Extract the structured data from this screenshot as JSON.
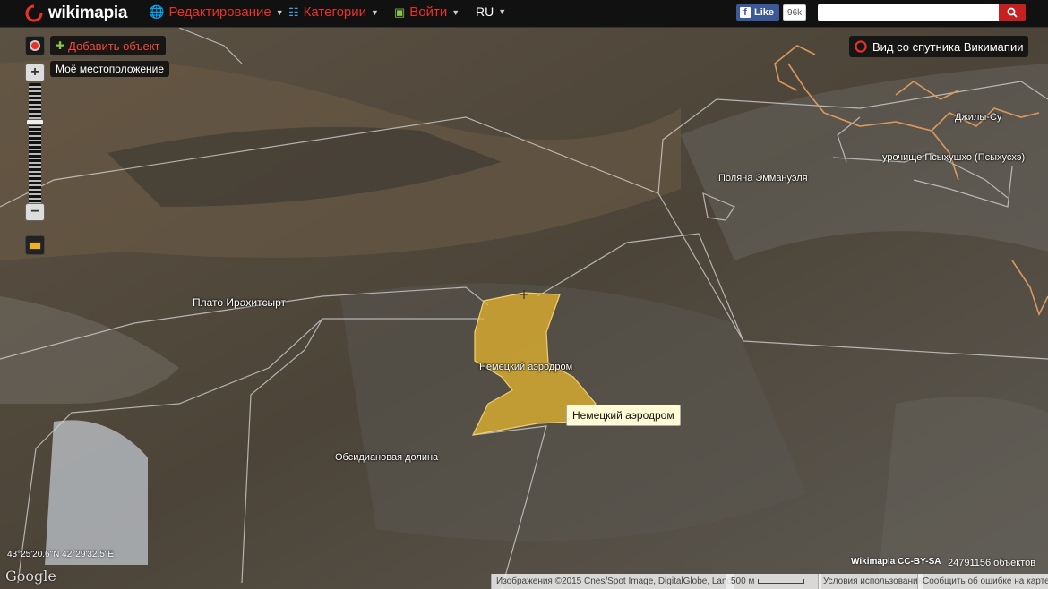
{
  "app": {
    "brand": "wikimapia",
    "brand_color": "#e8322c"
  },
  "topbar": {
    "menu_edit": "Редактирование",
    "menu_categories": "Категории",
    "menu_login": "Войти",
    "menu_lang": "RU",
    "fb_like": "Like",
    "fb_count": "96k",
    "search_placeholder": ""
  },
  "controls": {
    "add_object": "Добавить объект",
    "my_location": "Моё местоположение",
    "satellite_view": "Вид со спутника Викимапии"
  },
  "map": {
    "labels": {
      "plateau": "Плато Ирахитсырт",
      "obsidian_valley": "Обсидиановая долина",
      "airfield_label": "Немецкий аэродром",
      "emmanuel_glade": "Поляна Эммануэля",
      "dzhily_su": "Джилы-Су",
      "psykhushkho": "урочище Псыхушхо (Псыхусхэ)"
    },
    "tooltip": "Немецкий аэродром",
    "highlight_color": "#e6b42e"
  },
  "footer": {
    "coords": "43°25'20.6\"N 42°29'32.5\"E",
    "google": "Google",
    "imagery": "Изображения ©2015 Cnes/Spot Image, DigitalGlobe, Landsat",
    "scale": "500 м",
    "terms": "Условия использования",
    "report": "Сообщить об ошибке на карте",
    "license": "Wikimapia CC-BY-SA",
    "objects_count": "24791156 объектов"
  }
}
